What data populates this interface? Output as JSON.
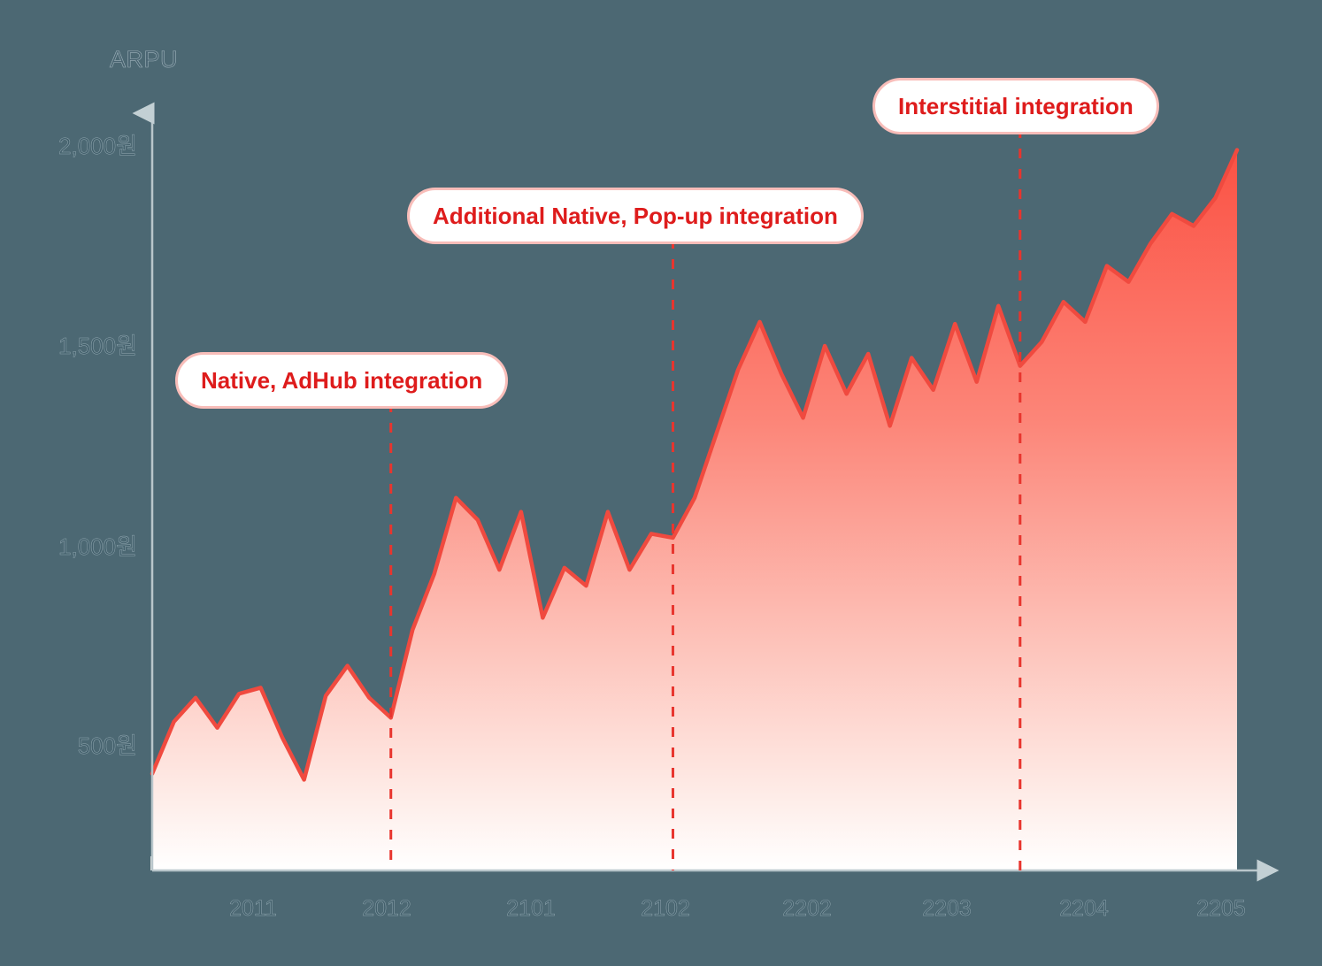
{
  "chart_data": {
    "type": "area",
    "title": "",
    "ylabel": "ARPU",
    "xlabel": "",
    "ylim": [
      0,
      2200
    ],
    "yticks": [
      500,
      1000,
      1500,
      2000
    ],
    "ytick_labels": [
      "500원",
      "1,000원",
      "1,500원",
      "2,000원"
    ],
    "xtick_labels": [
      "2011",
      "2012",
      "2101",
      "2102",
      "2202",
      "2203",
      "2204",
      "2205"
    ],
    "grid": false,
    "legend": false,
    "series": [
      {
        "name": "ARPU",
        "values": [
          430,
          560,
          620,
          545,
          630,
          645,
          520,
          415,
          625,
          700,
          620,
          570,
          790,
          930,
          1120,
          1065,
          940,
          1085,
          820,
          945,
          900,
          1085,
          940,
          1030,
          1020,
          1120,
          1280,
          1440,
          1560,
          1430,
          1320,
          1500,
          1380,
          1480,
          1300,
          1470,
          1390,
          1555,
          1410,
          1600,
          1450,
          1510,
          1610,
          1560,
          1700,
          1660,
          1755,
          1830,
          1800,
          1870,
          1990
        ]
      }
    ],
    "annotations": [
      {
        "label": "Native, AdHub integration",
        "x_index": 11
      },
      {
        "label": "Additional Native, Pop-up integration",
        "x_index": 24
      },
      {
        "label": "Interstitial integration",
        "x_index": 40
      }
    ],
    "colors": {
      "background": "#4c6873",
      "line": "#f04a3f",
      "area_top": "#fb5d4e",
      "area_bottom": "#ffffff",
      "annotation_text": "#de1c1c",
      "annotation_border": "#f8bdb9",
      "annotation_line": "#e8352e",
      "axis": "#b9c6cb",
      "tick_text": "#43606c"
    }
  },
  "axis": {
    "y_title": "ARPU"
  }
}
